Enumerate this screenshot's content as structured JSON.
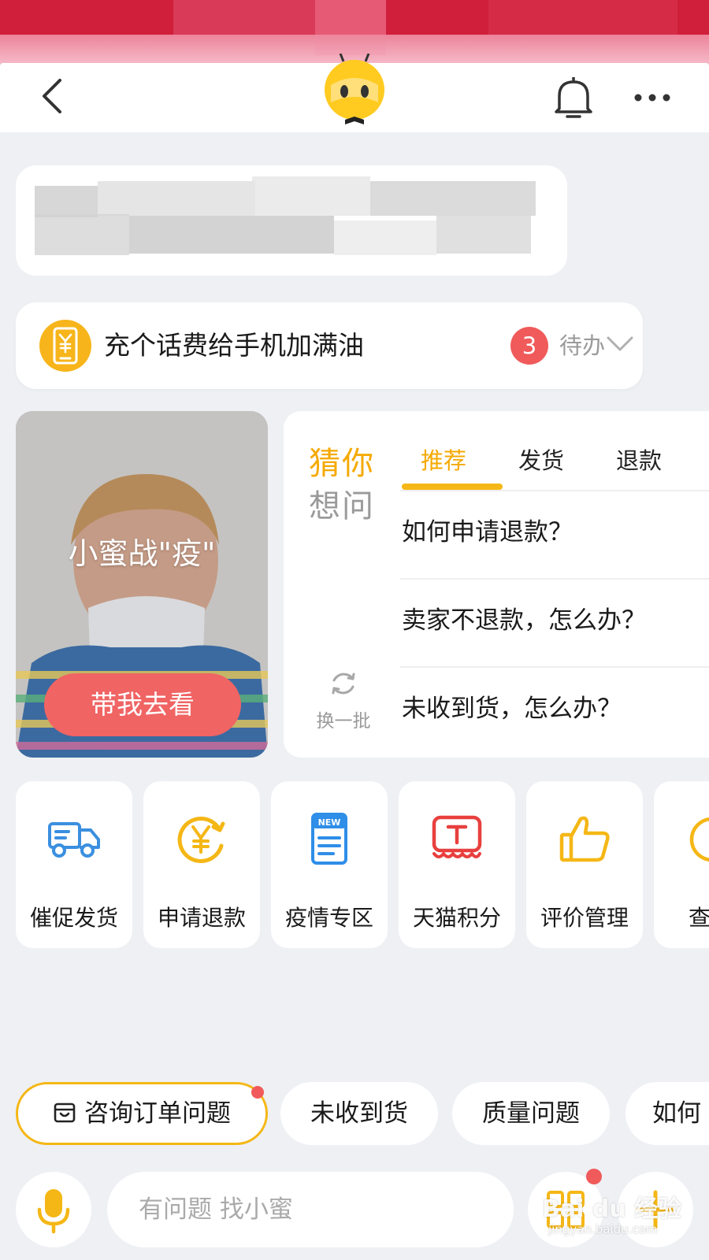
{
  "colors": {
    "accent": "#f5a900",
    "badge_red": "#f05a5a",
    "background": "#eef0f4"
  },
  "header": {
    "logo_icon": "mascot-logo",
    "back_icon": "chevron-left-icon",
    "bell_icon": "bell-icon",
    "more_icon": "more-dots-icon"
  },
  "tip": {
    "icon": "phone-recharge-icon",
    "text": "充个话费给手机加满油",
    "badge_count": "3",
    "todo_label": "待办"
  },
  "promo": {
    "title": "小蜜战\"疫\"",
    "button_label": "带我去看"
  },
  "guess": {
    "title_line1": "猜你",
    "title_line2": "想问",
    "tabs": [
      {
        "label": "推荐",
        "active": true
      },
      {
        "label": "发货",
        "active": false
      },
      {
        "label": "退款",
        "active": false
      }
    ],
    "questions": [
      "如何申请退款？",
      "卖家不退款，怎么办？",
      "未收到货，怎么办？"
    ],
    "refresh_label": "换一批"
  },
  "shortcuts": [
    {
      "label": "催促发货",
      "icon": "truck-icon"
    },
    {
      "label": "申请退款",
      "icon": "yen-refund-icon"
    },
    {
      "label": "疫情专区",
      "icon": "news-icon"
    },
    {
      "label": "天猫积分",
      "icon": "tmall-points-icon"
    },
    {
      "label": "评价管理",
      "icon": "thumbs-up-icon"
    },
    {
      "label": "查",
      "icon": "partial-icon"
    }
  ],
  "chips": [
    {
      "label": "咨询订单问题",
      "icon": "order-icon"
    },
    {
      "label": "未收到货"
    },
    {
      "label": "质量问题"
    },
    {
      "label": "如何"
    }
  ],
  "input": {
    "placeholder": "有问题 找小蜜"
  },
  "watermark": {
    "text": "Bai du 经验",
    "sub": "jingyan.baidu.com"
  }
}
